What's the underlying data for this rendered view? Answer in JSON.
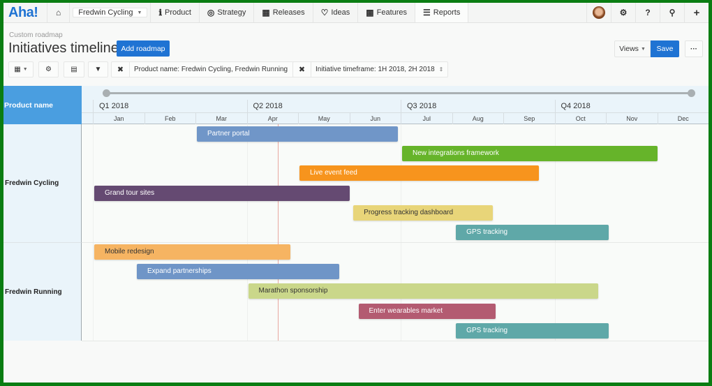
{
  "nav": {
    "logo": "Aha!",
    "product_selector": "Fredwin Cycling",
    "items": [
      {
        "label": "Product",
        "icon": "info-circle-icon",
        "glyph": "ℹ"
      },
      {
        "label": "Strategy",
        "icon": "target-icon",
        "glyph": "◎"
      },
      {
        "label": "Releases",
        "icon": "calendar-icon",
        "glyph": "▦"
      },
      {
        "label": "Ideas",
        "icon": "lightbulb-icon",
        "glyph": "♡"
      },
      {
        "label": "Features",
        "icon": "grid-icon",
        "glyph": "▩"
      },
      {
        "label": "Reports",
        "icon": "report-icon",
        "glyph": "☰",
        "active": true
      }
    ]
  },
  "header": {
    "breadcrumb": "Custom roadmap",
    "title": "Initiatives timeline",
    "add_roadmap": "Add roadmap",
    "views": "Views",
    "save": "Save",
    "more": "···"
  },
  "toolbar": {
    "filters": [
      {
        "label": "Product name: Fredwin Cycling, Fredwin Running"
      },
      {
        "label": "Initiative timeframe: 1H 2018, 2H 2018"
      }
    ]
  },
  "timeline": {
    "side_header": "Product name",
    "quarters": [
      "Q1 2018",
      "Q2 2018",
      "Q3 2018",
      "Q4 2018"
    ],
    "months": [
      "Jan",
      "Feb",
      "Mar",
      "Apr",
      "May",
      "Jun",
      "Jul",
      "Aug",
      "Sep",
      "Oct",
      "Nov",
      "Dec"
    ],
    "today_month": 3.6,
    "groups": [
      {
        "name": "Fredwin Cycling",
        "bars": [
          {
            "label": "Partner portal",
            "start": 2.0,
            "end": 5.95,
            "color": "#7096c8",
            "dark": false
          },
          {
            "label": "New integrations framework",
            "start": 6.0,
            "end": 11.0,
            "color": "#66b42a",
            "dark": false
          },
          {
            "label": "Live event feed",
            "start": 4.0,
            "end": 8.7,
            "color": "#f7941d",
            "dark": false
          },
          {
            "label": "Grand tour sites",
            "start": 0.0,
            "end": 5.0,
            "color": "#654a72",
            "dark": false
          },
          {
            "label": "Progress tracking dashboard",
            "start": 5.05,
            "end": 7.8,
            "color": "#e8d579",
            "dark": true
          },
          {
            "label": "GPS tracking",
            "start": 7.05,
            "end": 10.05,
            "color": "#5fa8a8",
            "dark": false
          }
        ]
      },
      {
        "name": "Fredwin Running",
        "bars": [
          {
            "label": "Mobile redesign",
            "start": 0.0,
            "end": 3.85,
            "color": "#f6b462",
            "dark": true
          },
          {
            "label": "Expand partnerships",
            "start": 0.83,
            "end": 4.8,
            "color": "#6f95c7",
            "dark": false
          },
          {
            "label": "Marathon sponsorship",
            "start": 3.0,
            "end": 9.85,
            "color": "#cad78a",
            "dark": true
          },
          {
            "label": "Enter wearables market",
            "start": 5.15,
            "end": 7.85,
            "color": "#b35b71",
            "dark": false
          },
          {
            "label": "GPS tracking",
            "start": 7.05,
            "end": 10.05,
            "color": "#5fa8a8",
            "dark": false
          }
        ]
      }
    ]
  }
}
